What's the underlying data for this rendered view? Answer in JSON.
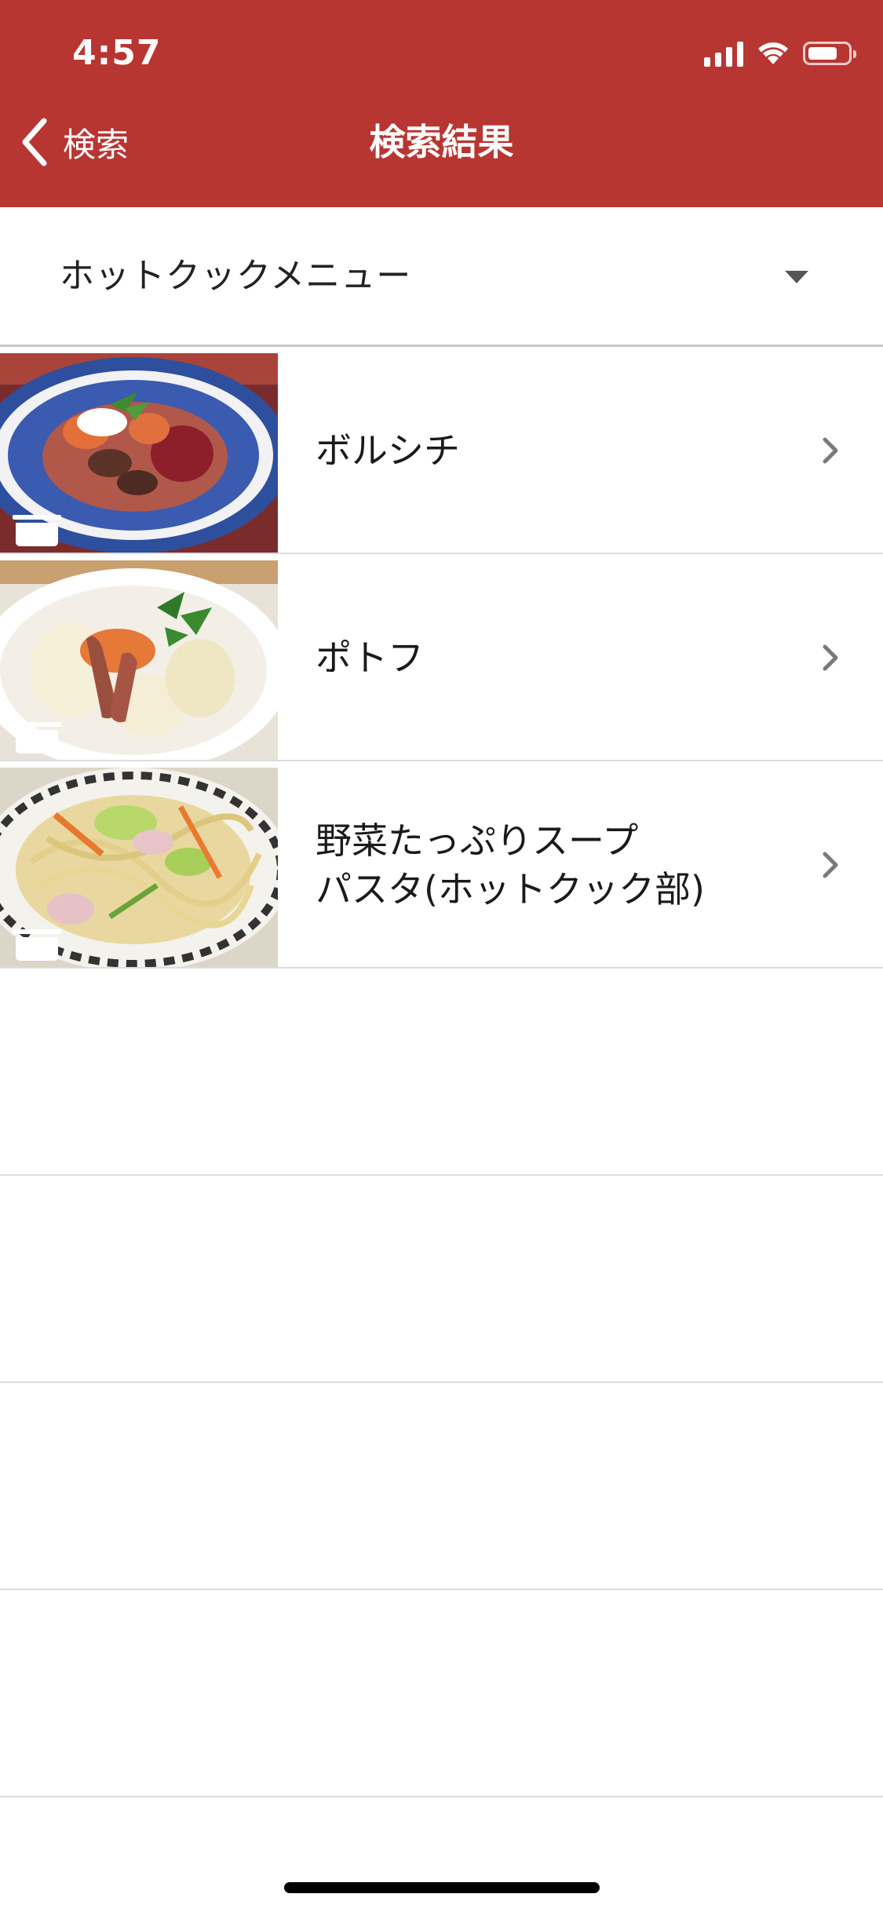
{
  "status_bar": {
    "time": "4:57",
    "signal_level": 4,
    "battery_level": 0.75,
    "wifi_icon": "wifi-icon"
  },
  "nav": {
    "back_label": "検索",
    "title": "検索結果",
    "background_color": "#b83632"
  },
  "category": {
    "selected": "ホットクックメニュー"
  },
  "results": [
    {
      "title_lines": [
        "ボルシチ"
      ],
      "icon": "hotcook-pot-icon"
    },
    {
      "title_lines": [
        "ポトフ"
      ],
      "icon": "hotcook-pot-icon"
    },
    {
      "title_lines": [
        "野菜たっぷりスープ",
        "パスタ(ホットクック部)"
      ],
      "icon": "hotcook-pot-icon"
    }
  ],
  "empty_rows": 4
}
